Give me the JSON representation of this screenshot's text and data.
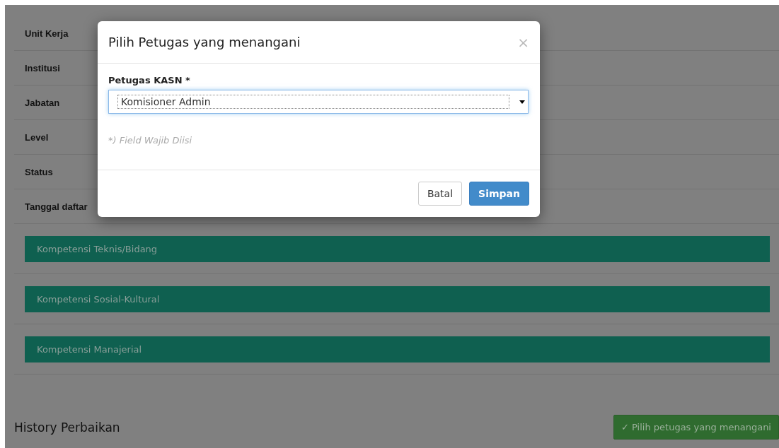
{
  "details": [
    {
      "label": "Unit Kerja"
    },
    {
      "label": "Institusi"
    },
    {
      "label": "Jabatan"
    },
    {
      "label": "Level"
    },
    {
      "label": "Status"
    },
    {
      "label": "Tanggal daftar"
    }
  ],
  "panels": [
    {
      "title": "Kompetensi Teknis/Bidang"
    },
    {
      "title": "Kompetensi Sosial-Kultural"
    },
    {
      "title": "Kompetensi Manajerial"
    }
  ],
  "history": {
    "title": "History Perbaikan",
    "button": "✓ Pilih petugas yang menangani"
  },
  "modal": {
    "title": "Pilih Petugas yang menangani",
    "close": "×",
    "field_label": "Petugas KASN *",
    "field_value": "Komisioner Admin",
    "note": "*) Field Wajib Diisi",
    "buttons": [
      {
        "label": "Batal",
        "kind": "default"
      },
      {
        "label": "Simpan",
        "kind": "primary"
      }
    ]
  }
}
